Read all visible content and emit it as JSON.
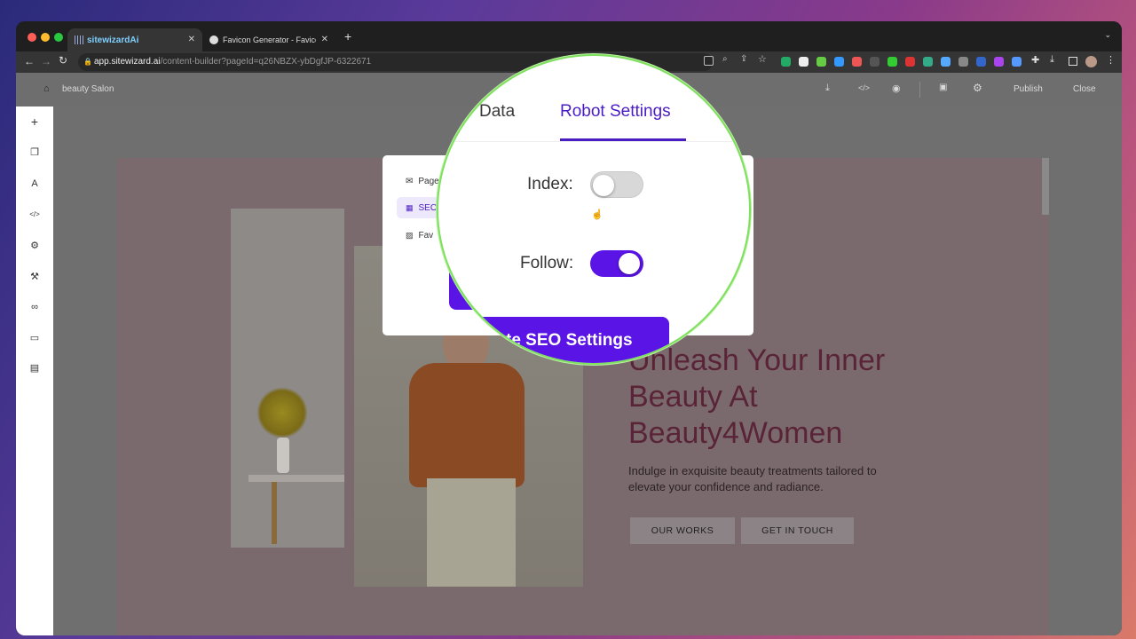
{
  "browser": {
    "tabs": [
      {
        "label": "sitewizardAi",
        "active": true
      },
      {
        "label": "Favicon Generator - Favicon f",
        "active": false
      }
    ],
    "new_tab": "+",
    "url_host": "app.sitewizard.ai",
    "url_path": "/content-builder?pageId=q26NBZX-ybDgfJP-6322671"
  },
  "topbar": {
    "title": "beauty Salon",
    "publish": "Publish",
    "close": "Close"
  },
  "sidebar": {
    "icons": [
      "plus-icon",
      "copy-icon",
      "text-icon",
      "code-icon",
      "settings-icon",
      "magic-wand-icon",
      "link-icon",
      "comment-icon",
      "clipboard-icon"
    ]
  },
  "hero": {
    "heading_lines": [
      "Unleash Your Inner",
      "Beauty At",
      "Beauty4Women"
    ],
    "paragraph_lines": [
      "Indulge in exquisite beauty treatments tailored to",
      "elevate your confidence and radiance."
    ],
    "btn_works": "OUR WORKS",
    "btn_touch": "GET IN TOUCH"
  },
  "modal": {
    "nav": [
      {
        "label": "Page",
        "icon": "mail-icon"
      },
      {
        "label": "SEO",
        "icon": "grid-icon",
        "selected": true
      },
      {
        "label": "Fav",
        "icon": "image-icon"
      }
    ],
    "update_button": "te SEO Settings"
  },
  "magnifier": {
    "tab_partial": "Data",
    "tab_active": "Robot Settings",
    "index_label": "Index:",
    "index_on": false,
    "follow_label": "Follow:",
    "follow_on": true
  },
  "colors": {
    "accent": "#4a1dc4",
    "toggle_on": "#5a14e6",
    "toggle_off": "#d8d8d8",
    "lens_border": "#7ee05e",
    "heading": "#5a2438"
  }
}
